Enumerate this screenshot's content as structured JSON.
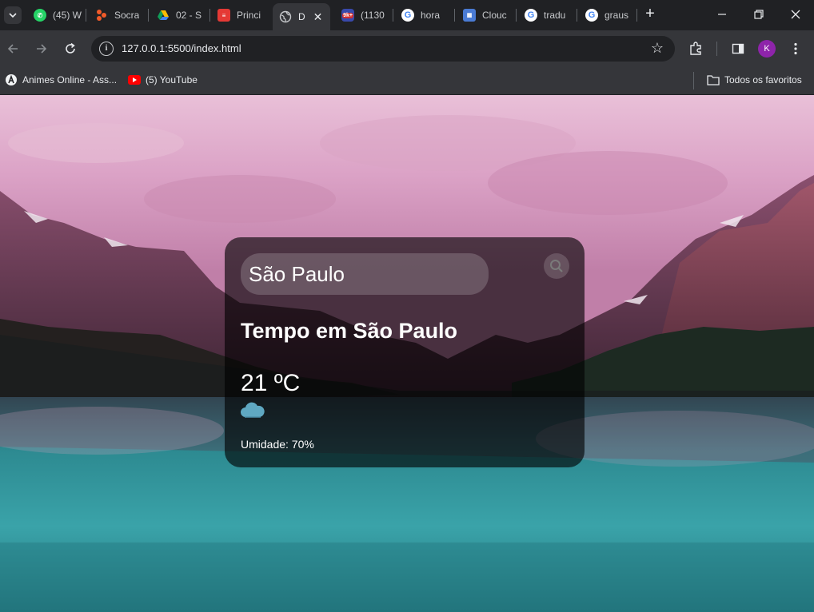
{
  "browser": {
    "tabs": [
      {
        "title": "(45) W",
        "favicon": "whatsapp-icon",
        "color": "#25d366"
      },
      {
        "title": "Socra",
        "favicon": "socratica-icon",
        "color": "#f15a29"
      },
      {
        "title": "02 - S",
        "favicon": "google-drive-icon",
        "color": "#4285f4"
      },
      {
        "title": "Princi",
        "favicon": "doc-icon",
        "color": "#e53935"
      },
      {
        "title": "D",
        "favicon": "globe-icon",
        "color": "#9aa0a6",
        "active": true
      },
      {
        "title": "(1130",
        "favicon": "mail-icon",
        "color": "#3949ab",
        "badge": "9k+"
      },
      {
        "title": "hora",
        "favicon": "google-icon",
        "color": "#ffffff"
      },
      {
        "title": "Clouc",
        "favicon": "cloud-icon",
        "color": "#4a7bd4"
      },
      {
        "title": "tradu",
        "favicon": "google-icon",
        "color": "#ffffff"
      },
      {
        "title": "graus",
        "favicon": "google-icon",
        "color": "#ffffff"
      }
    ],
    "url": "127.0.0.1:5500/index.html",
    "profile_initial": "K",
    "bookmarks": [
      {
        "label": "Animes Online - Ass...",
        "icon": "animes-icon"
      },
      {
        "label": "(5) YouTube",
        "icon": "youtube-icon"
      }
    ],
    "all_bookmarks_label": "Todos os favoritos"
  },
  "weather": {
    "search_value": "São Paulo",
    "title": "Tempo em São Paulo",
    "temperature": "21 ºC",
    "icon": "cloud-icon",
    "icon_color": "#5fa8c2",
    "humidity": "Umidade: 70%"
  }
}
